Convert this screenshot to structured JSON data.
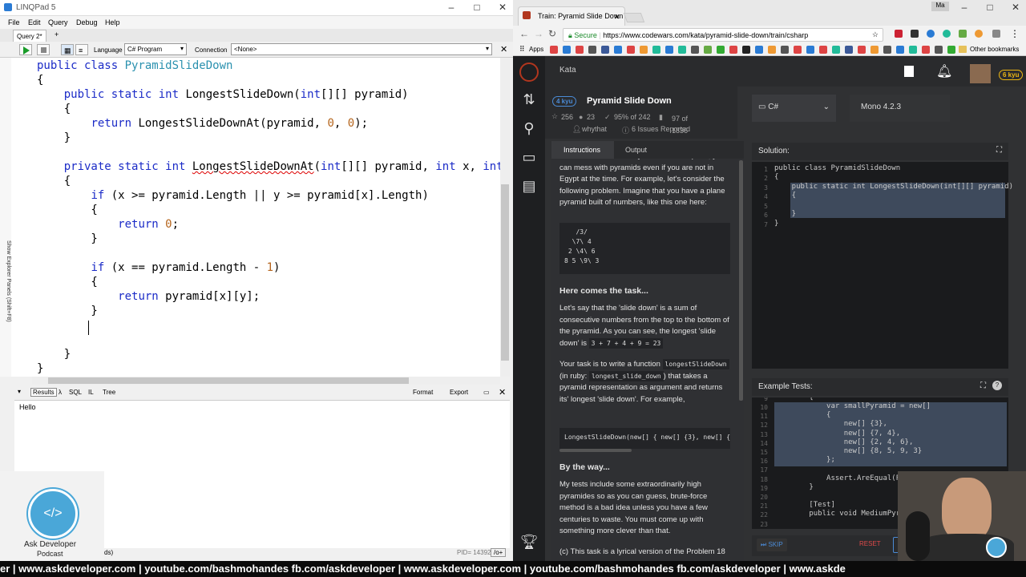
{
  "linqpad": {
    "title": "LINQPad 5",
    "menu": [
      "File",
      "Edit",
      "Query",
      "Debug",
      "Help"
    ],
    "tab": "Query 2*",
    "tab_add": "+",
    "language_label": "Language",
    "language_value": "C# Program",
    "connection_label": "Connection",
    "connection_value": "<None>",
    "code": [
      "public class PyramidSlideDown",
      "{",
      "    public static int LongestSlideDown(int[][] pyramid)",
      "    {",
      "        return LongestSlideDownAt(pyramid, 0, 0);",
      "    }",
      "",
      "    private static int LongestSlideDownAt(int[][] pyramid, int x, int y)",
      "    {",
      "        if (x >= pyramid.Length || y >= pyramid[x].Length)",
      "        {",
      "            return 0;",
      "        }",
      "",
      "        if (x == pyramid.Length - 1)",
      "        {",
      "            return pyramid[x][y];",
      "        }",
      "",
      "",
      "    }",
      "}"
    ],
    "results_tabs": [
      "Results",
      "λ",
      "SQL",
      "IL",
      "Tree"
    ],
    "format_label": "Format",
    "export_label": "Export",
    "output": "Hello",
    "side_text": "Show Explorer Panels (Shift+F8)",
    "status_left": "ds)",
    "status_pid": "PID= 14392",
    "status_mode": "/o+"
  },
  "chrome": {
    "tab_title": "Train: Pyramid Slide Down",
    "secure": "Secure",
    "url": "https://www.codewars.com/kata/pyramid-slide-down/train/csharp",
    "apps": "Apps",
    "other_bookmarks": "Other bookmarks",
    "profile": "Ma"
  },
  "codewars": {
    "section": "Kata",
    "rank": "6 kyu",
    "honor": "191",
    "kata_rank": "4 kyu",
    "kata_name": "Pyramid Slide Down",
    "stars": "256",
    "comments": "23",
    "satisfaction": "95% of 242",
    "completed": "97 of 1836",
    "author": "whythat",
    "issues": "6 Issues Reported",
    "language": "C#",
    "runtime": "Mono 4.2.3",
    "tab_instructions": "Instructions",
    "tab_output": "Output",
    "desc_top": "mathematical sense. If you have a computer, you can mess with pyramids even if you are not in Egypt at the time. For example, let's consider the following problem. Imagine that you have a plane pyramid built of numbers, like this one here:",
    "pyramid_ascii": "   /3/\n  \\7\\ 4\n 2 \\4\\ 6\n8 5 \\9\\ 3",
    "h_task": "Here comes the task...",
    "p_task1": "Let's say that the 'slide down' is a sum of consecutive numbers from the top to the bottom of the pyramid. As you can see, the longest 'slide down' is",
    "task_sum": "3 + 7 + 4 + 9 = 23",
    "p_task2a": "Your task is to write a function",
    "fn_name": "longestSlideDown",
    "p_task2b": "(in ruby:",
    "fn_ruby": "longest_slide_down",
    "p_task2c": ") that takes a pyramid representation as argument and returns its' longest 'slide down'. For example,",
    "example_call": "LongestSlideDown(new[] { new[] {3}, new[] {",
    "h_way": "By the way...",
    "p_way": "My tests include some extraordinarily high pyramides so as you can guess, brute-force method is a bad idea unless you have a few centuries to waste. You must come up with something more clever than that.",
    "p_foot": "(c) This task is a lyrical version of the Problem 18",
    "solution_label": "Solution:",
    "solution_lines": [
      "public class PyramidSlideDown",
      "{",
      "    public static int LongestSlideDown(int[][] pyramid)",
      "    {",
      "",
      "    }",
      "}"
    ],
    "solution_nums": [
      "1",
      "2",
      "3",
      "4",
      "5",
      "6",
      "7"
    ],
    "tests_label": "Example Tests:",
    "test_nums": [
      "9",
      "10",
      "11",
      "12",
      "13",
      "14",
      "15",
      "16",
      "17",
      "18",
      "19",
      "20",
      "21",
      "22",
      "23"
    ],
    "test_lines": [
      "        {",
      "            var smallPyramid = new[]",
      "            {",
      "                new[] {3},",
      "                new[] {7, 4},",
      "                new[] {2, 4, 6},",
      "                new[] {8, 5, 9, 3}",
      "            };",
      "",
      "            Assert.AreEqual(Pyra",
      "        }",
      "",
      "        [Test]",
      "        public void MediumPyrami",
      ""
    ],
    "skip": "SKIP",
    "reset": "RESET"
  },
  "overlay": {
    "podcast_line1": "Ask Developer",
    "podcast_line2": "Podcast",
    "ticker": "er | www.askdeveloper.com | youtube.com/bashmohandes  fb.com/askdeveloper | www.askdeveloper.com | youtube.com/bashmohandes  fb.com/askdeveloper | www.askde"
  }
}
